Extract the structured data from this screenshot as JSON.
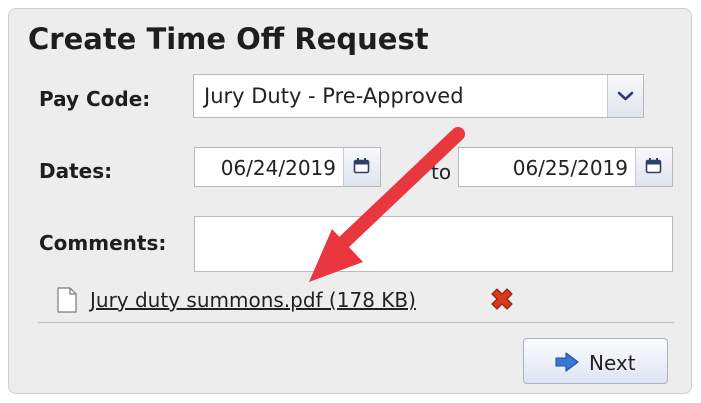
{
  "dialog": {
    "title": "Create Time Off Request"
  },
  "pay_code": {
    "label": "Pay Code:",
    "selected": "Jury Duty - Pre-Approved"
  },
  "dates": {
    "label": "Dates:",
    "start": "06/24/2019",
    "separator": "to",
    "end": "06/25/2019"
  },
  "comments": {
    "label": "Comments:",
    "value": ""
  },
  "attachment": {
    "name": "Jury duty summons.pdf (178 KB)"
  },
  "actions": {
    "next_label": "Next"
  },
  "icons": {
    "dropdown": "chevron-down-icon",
    "calendar": "calendar-icon",
    "file": "file-icon",
    "remove": "remove-x-icon",
    "next": "arrow-right-icon"
  },
  "colors": {
    "annotation_arrow": "#e8373e",
    "remove_icon": "#d43a1b",
    "next_arrow": "#3a78d6"
  }
}
